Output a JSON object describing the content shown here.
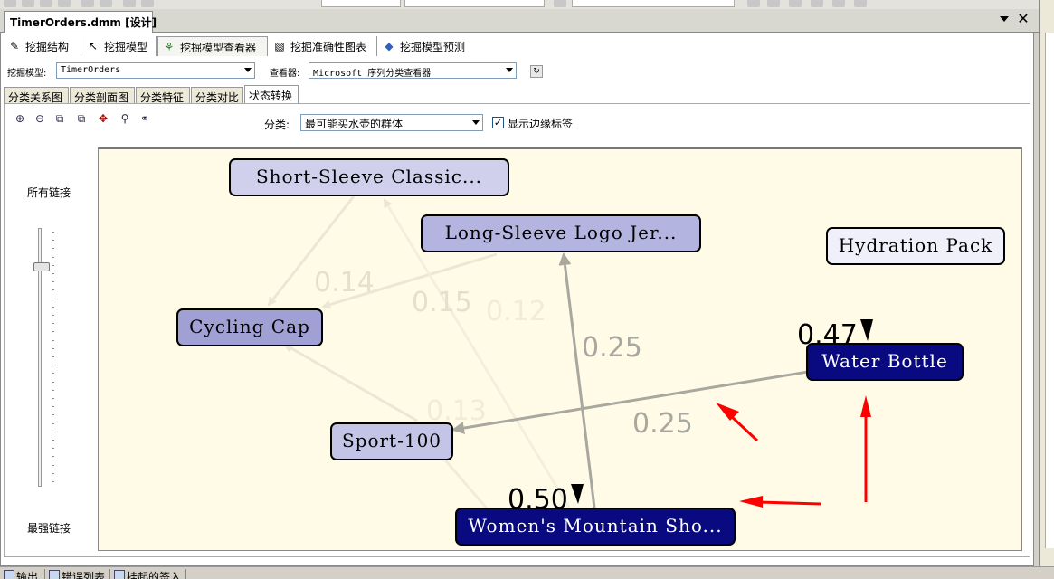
{
  "document_tab": {
    "title": "TimerOrders.dmm [设计]",
    "close_glyph": "✕",
    "dropdown_glyph": "▼"
  },
  "main_tabs": [
    {
      "label": "挖掘结构",
      "icon": "structure-icon"
    },
    {
      "label": "挖掘模型",
      "icon": "model-icon"
    },
    {
      "label": "挖掘模型查看器",
      "icon": "viewer-icon"
    },
    {
      "label": "挖掘准确性图表",
      "icon": "accuracy-chart-icon"
    },
    {
      "label": "挖掘模型预测",
      "icon": "prediction-icon"
    }
  ],
  "model_select": {
    "label": "挖掘模型:",
    "value": "TimerOrders"
  },
  "viewer_select": {
    "label": "查看器:",
    "value": "Microsoft 序列分类查看器"
  },
  "sub_tabs": [
    "分类关系图",
    "分类剖面图",
    "分类特征",
    "分类对比",
    "状态转换"
  ],
  "active_sub_tab": "状态转换",
  "toolbar_icons": [
    "zoom-in-icon",
    "zoom-out-icon",
    "copy-icon",
    "copy-graph-icon",
    "fit-to-window-icon",
    "find-node-icon",
    "layout-icon"
  ],
  "cluster_filter": {
    "label": "分类:",
    "value": "最可能买水壶的群体"
  },
  "edge_labels_option": {
    "label": "显示边缘标签",
    "checked": true,
    "check_glyph": "✓"
  },
  "link_slider": {
    "top_label": "所有链接",
    "bottom_label": "最强链接",
    "level": 0.15
  },
  "graph": {
    "nodes": [
      {
        "id": "short-sleeve",
        "label": "Short-Sleeve Classic...",
        "fill": "#d0d0ec",
        "text_color": "#000000"
      },
      {
        "id": "long-sleeve",
        "label": "Long-Sleeve Logo Jer...",
        "fill": "#b4b4e0",
        "text_color": "#000000"
      },
      {
        "id": "hydration-pack",
        "label": "Hydration Pack",
        "fill": "#f0f0fa",
        "text_color": "#000000"
      },
      {
        "id": "cycling-cap",
        "label": "Cycling Cap",
        "fill": "#a0a0d4",
        "text_color": "#000000"
      },
      {
        "id": "water-bottle",
        "label": "Water Bottle",
        "fill": "#0a0a80",
        "text_color": "#ffffff"
      },
      {
        "id": "sport-100",
        "label": "Sport-100",
        "fill": "#c4c4e6",
        "text_color": "#000000"
      },
      {
        "id": "womens-mountain",
        "label": "Women's Mountain Sho...",
        "fill": "#0a0a80",
        "text_color": "#ffffff"
      }
    ],
    "edge_labels": [
      {
        "text": "0.14",
        "color": "#e4e0cc"
      },
      {
        "text": "0.15",
        "color": "#e4e0cc"
      },
      {
        "text": "0.12",
        "color": "#f0ecd8"
      },
      {
        "text": "0.25",
        "color": "#a8a8a0"
      },
      {
        "text": "0.25",
        "color": "#a8a8a0"
      },
      {
        "text": "0.13",
        "color": "#f0ecd8"
      }
    ],
    "self_loop_labels": [
      {
        "text": "0.47",
        "color": "#000000"
      },
      {
        "text": "0.50",
        "color": "#000000"
      }
    ]
  },
  "bottom_tabs": [
    "输出",
    "错误列表",
    "挂起的签入"
  ],
  "colors": {
    "annotation_arrow": "#ff0000",
    "graph_background": "#fffbe6",
    "strong_edge": "#a8a8a0",
    "weak_edge": "#ebe7d4"
  }
}
